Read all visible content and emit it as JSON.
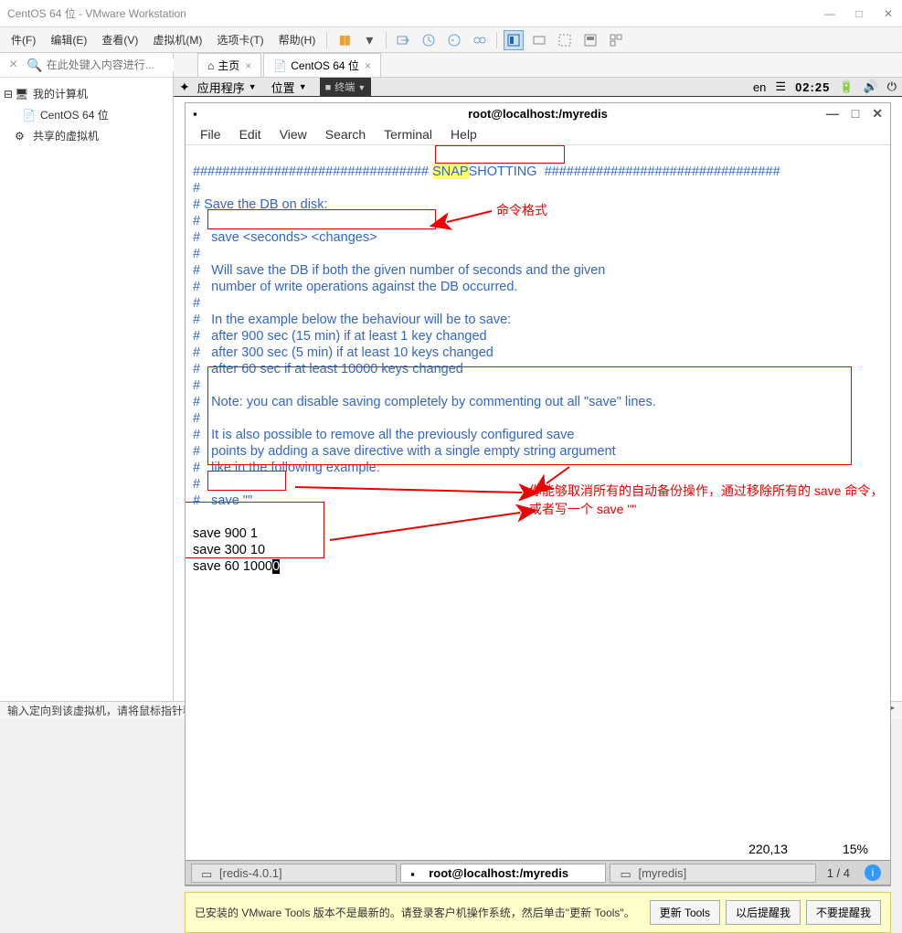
{
  "window": {
    "title": "CentOS 64 位 - VMware Workstation"
  },
  "menubar": {
    "items": [
      "件(F)",
      "编辑(E)",
      "查看(V)",
      "虚拟机(M)",
      "选项卡(T)",
      "帮助(H)"
    ]
  },
  "sidebar": {
    "search_placeholder": "在此处键入内容进行...",
    "root": "我的计算机",
    "vm": "CentOS 64 位",
    "shared": "共享的虚拟机"
  },
  "tabs": {
    "home": "主页",
    "vm": "CentOS 64 位"
  },
  "vm_top": {
    "apps": "应用程序",
    "location": "位置",
    "terminal": "终端",
    "lang": "en",
    "time": "02:25"
  },
  "terminal": {
    "title": "root@localhost:/myredis",
    "menu": [
      "File",
      "Edit",
      "View",
      "Search",
      "Terminal",
      "Help"
    ],
    "snap_prefix": "SNAP",
    "snap_suffix": "SHOTTING",
    "lines": {
      "l1": "# Save the DB on disk:",
      "l2": "#   save <seconds> <changes>",
      "l3": "#   Will save the DB if both the given number of seconds and the given",
      "l4": "#   number of write operations against the DB occurred.",
      "l5": "#   In the example below the behaviour will be to save:",
      "l6": "#   after 900 sec (15 min) if at least 1 key changed",
      "l7": "#   after 300 sec (5 min) if at least 10 keys changed",
      "l8": "#   after 60 sec if at least 10000 keys changed",
      "l9": "#   Note: you can disable saving completely by commenting out all \"save\" lines.",
      "l10": "#   It is also possible to remove all the previously configured save",
      "l11": "#   points by adding a save directive with a single empty string argument",
      "l12": "#   like in the following example:",
      "l13": "#   save \"\"",
      "s1": "save 900 1",
      "s2": "save 300 10",
      "s3_pre": "save 60 1000",
      "s3_cursor": "0"
    },
    "annotations": {
      "a1": "命令格式",
      "a2": "你能够取消所有的自动备份操作，通过移除所有的 save 命令，或者写一个 save \"\""
    },
    "status": {
      "pos": "220,13",
      "pct": "15%"
    }
  },
  "bottom_tabs": {
    "t1": "[redis-4.0.1]",
    "t2": "root@localhost:/myredis",
    "t3": "[myredis]",
    "page": "1 / 4"
  },
  "notif": {
    "msg": "已安装的 VMware Tools 版本不是最新的。请登录客户机操作系统，然后单击\"更新 Tools\"。",
    "b1": "更新 Tools",
    "b2": "以后提醒我",
    "b3": "不要提醒我"
  },
  "footer": {
    "msg": "输入定向到该虚拟机，请将鼠标指针移入其中或按 Ctrl+G。"
  }
}
